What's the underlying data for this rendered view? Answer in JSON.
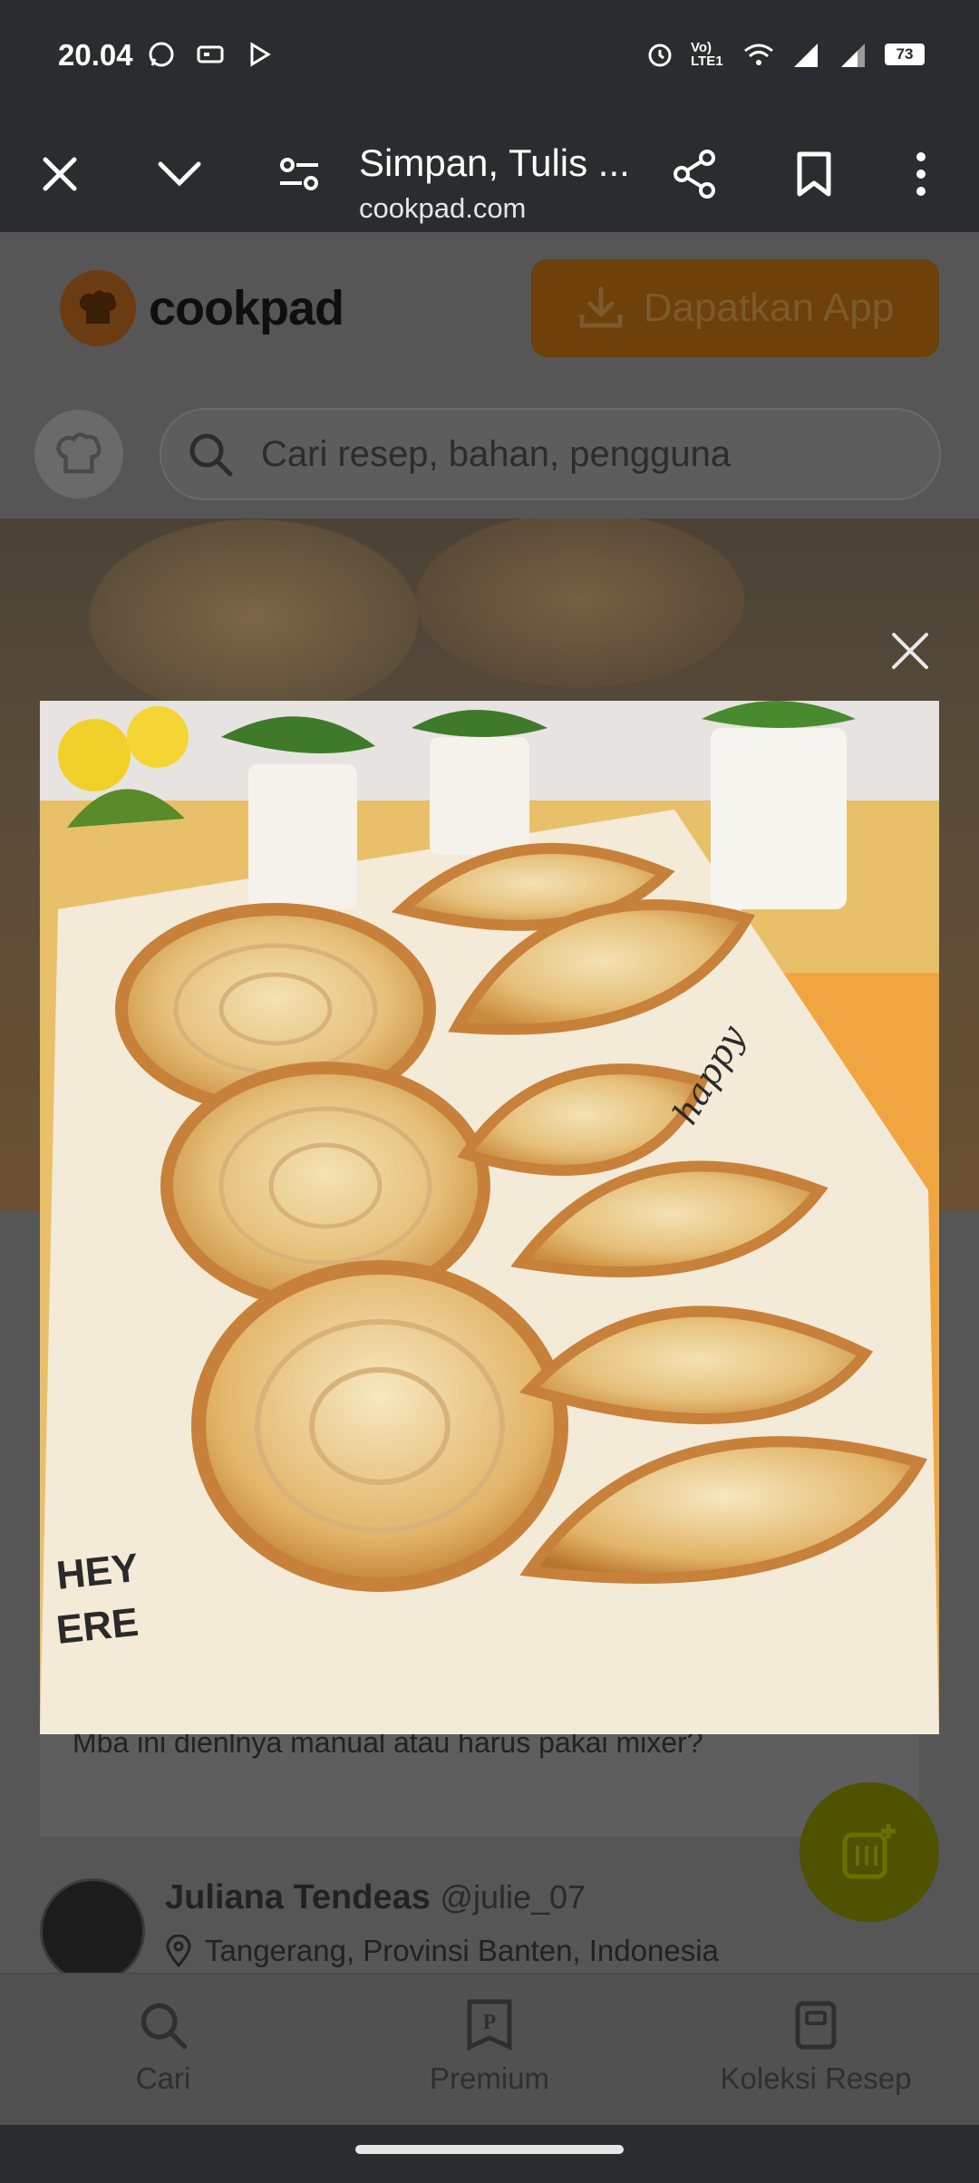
{
  "status_bar": {
    "time": "20.04",
    "network_label": "Vo) LTE1",
    "battery": "73"
  },
  "browser": {
    "title": "Simpan, Tulis ...",
    "url": "cookpad.com"
  },
  "header": {
    "logo_text": "cookpad",
    "get_app_label": "Dapatkan App",
    "search_placeholder": "Cari resep, bahan, pengguna"
  },
  "comment": {
    "text": "Mba ini dienlnya manual atau harus pakai mixer?"
  },
  "author": {
    "name": "Juliana Tendeas",
    "handle": "@julie_07",
    "location": "Tangerang, Provinsi Banten, Indonesia"
  },
  "bottom_nav": {
    "items": [
      {
        "label": "Cari",
        "icon": "search-icon"
      },
      {
        "label": "Premium",
        "icon": "premium-icon"
      },
      {
        "label": "Koleksi Resep",
        "icon": "recipe-book-icon"
      }
    ]
  },
  "colors": {
    "brand_orange": "#f28c1f",
    "fab_green": "#7a8000",
    "system_bar": "#2b2c30"
  }
}
